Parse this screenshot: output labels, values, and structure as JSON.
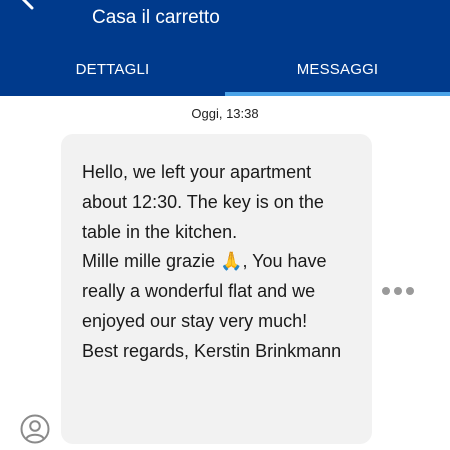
{
  "header": {
    "title": "Casa il carretto",
    "back_icon": "back-arrow-icon",
    "background": "#003a8c",
    "accent": "#4aa3e8"
  },
  "tabs": [
    {
      "label": "DETTAGLI",
      "selected": false
    },
    {
      "label": "MESSAGGI",
      "selected": true
    }
  ],
  "conversation": {
    "timestamp": "Oggi, 13:38",
    "message": "Hello, we left your apartment about 12:30. The key is on the table in the kitchen.\nMille mille grazie 🙏, You have really a wonderful flat and we enjoyed our stay very much!\nBest regards, Kerstin Brinkmann",
    "more_icon": "more-horizontal-icon",
    "avatar_icon": "user-avatar-icon"
  }
}
